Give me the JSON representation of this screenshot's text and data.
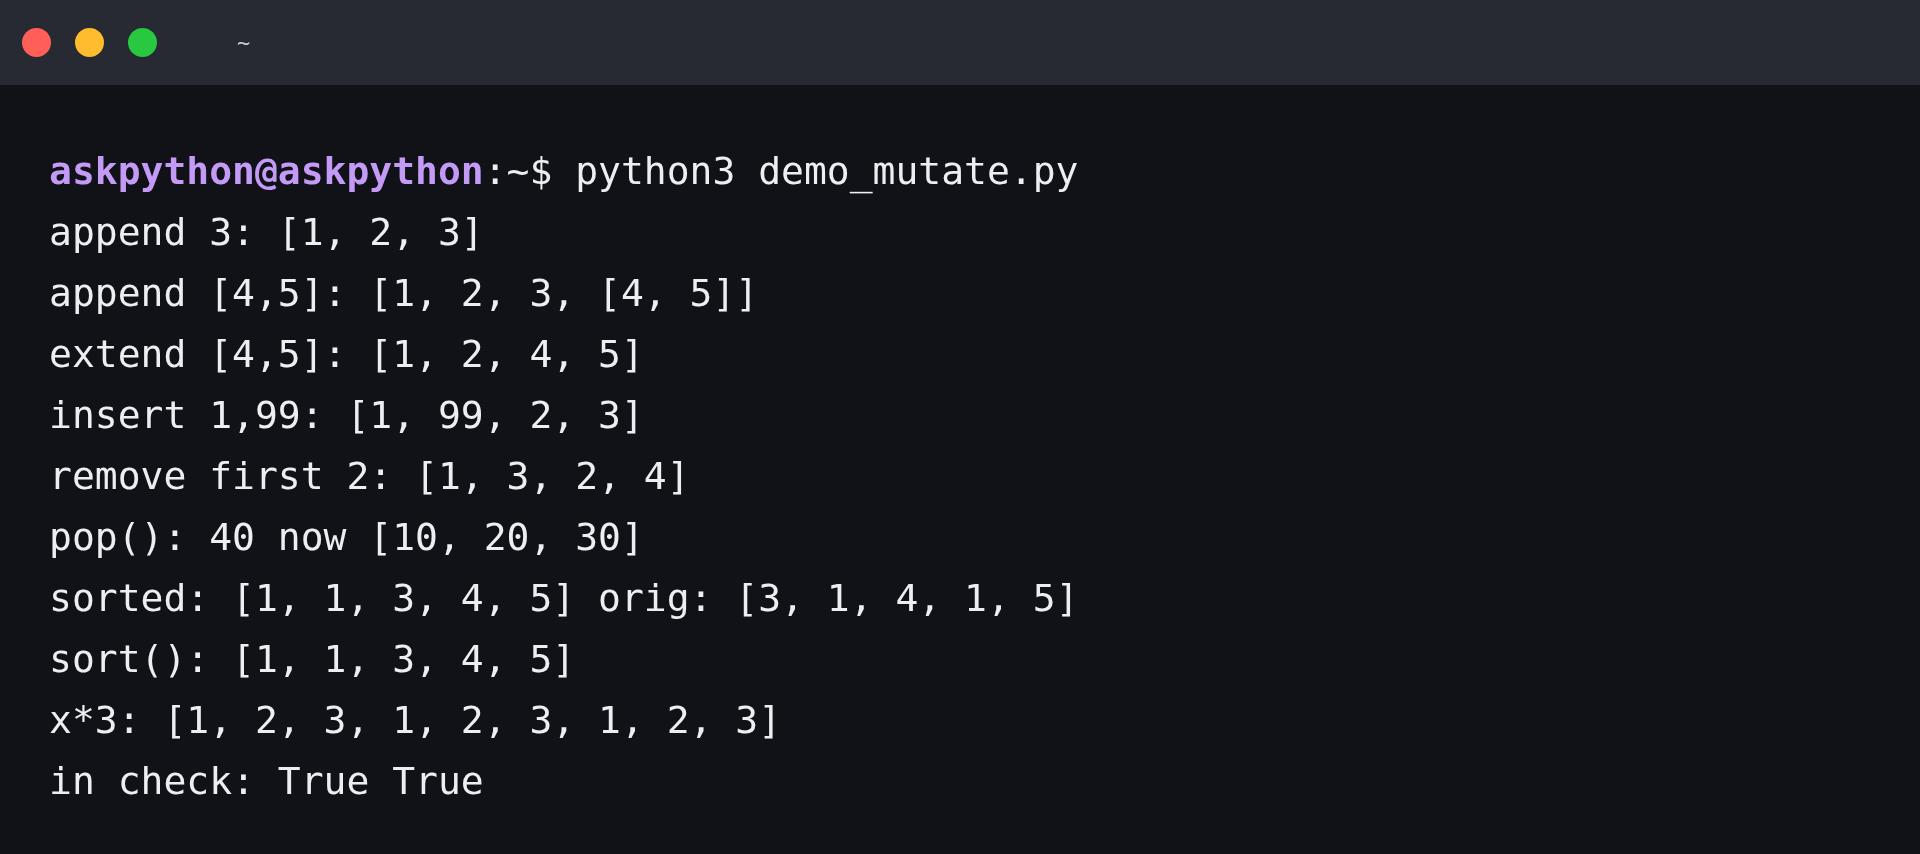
{
  "window": {
    "title": "~"
  },
  "prompt": {
    "user_host": "askpython@askpython",
    "path": ":~$",
    "command": "python3 demo_mutate.py"
  },
  "output": [
    "append 3: [1, 2, 3]",
    "append [4,5]: [1, 2, 3, [4, 5]]",
    "extend [4,5]: [1, 2, 4, 5]",
    "insert 1,99: [1, 99, 2, 3]",
    "remove first 2: [1, 3, 2, 4]",
    "pop(): 40 now [10, 20, 30]",
    "sorted: [1, 1, 3, 4, 5] orig: [3, 1, 4, 1, 5]",
    "sort(): [1, 1, 3, 4, 5]",
    "x*3: [1, 2, 3, 1, 2, 3, 1, 2, 3]",
    "in check: True True"
  ]
}
